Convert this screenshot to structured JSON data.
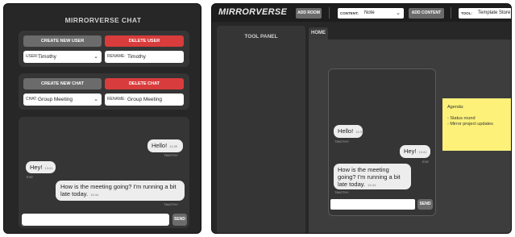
{
  "left": {
    "title": "MIRRORVERSE CHAT",
    "user_panel": {
      "create_label": "CREATE NEW USER",
      "delete_label": "DELETE USER",
      "user_label": "USER:",
      "user_value": "Timothy",
      "rename_label": "RENAME:",
      "rename_value": "Timothy"
    },
    "chat_panel": {
      "create_label": "CREATE NEW CHAT",
      "delete_label": "DELETE CHAT",
      "chat_label": "CHAT:",
      "chat_value": "Group Meeting",
      "rename_label": "RENAME:",
      "rename_value": "Group Meeting"
    },
    "messages": [
      {
        "text": "Hello!",
        "time": "13:39",
        "sender": "TIMOTHY",
        "side": "right"
      },
      {
        "text": "Hey!",
        "time": "13:41",
        "sender": "EVE",
        "side": "left"
      },
      {
        "text": "How is the meeting going? I'm running a bit late today.",
        "time": "13:44",
        "sender": "TIMOTHY",
        "side": "right"
      }
    ],
    "send_label": "SEND"
  },
  "right": {
    "logo": "MIRRORVERSE",
    "add_room_label": "ADD ROOM",
    "content_label": "CONTENT:",
    "content_value": "Note",
    "add_content_label": "ADD CONTENT",
    "tool_label": "TOOL:",
    "tool_value": "Template Store",
    "tool_panel_title": "TOOL PANEL",
    "home_tab": "HOME",
    "mirror_messages": [
      {
        "text": "Hello!",
        "time": "13:39",
        "sender": "TIMOTHY",
        "side": "left"
      },
      {
        "text": "Hey!",
        "time": "13:41",
        "sender": "EVE",
        "side": "right"
      },
      {
        "text": "How is the meeting going? I'm running a bit late today.",
        "time": "13:44",
        "sender": "TIMOTHY",
        "side": "left"
      }
    ],
    "send_label": "SEND",
    "note": {
      "title": "Agenda:",
      "line1": "- Status round",
      "line2": "- Mirror project updates"
    }
  },
  "colors": {
    "accent_red": "#d93c3c",
    "note_yellow": "#fdf17a"
  }
}
